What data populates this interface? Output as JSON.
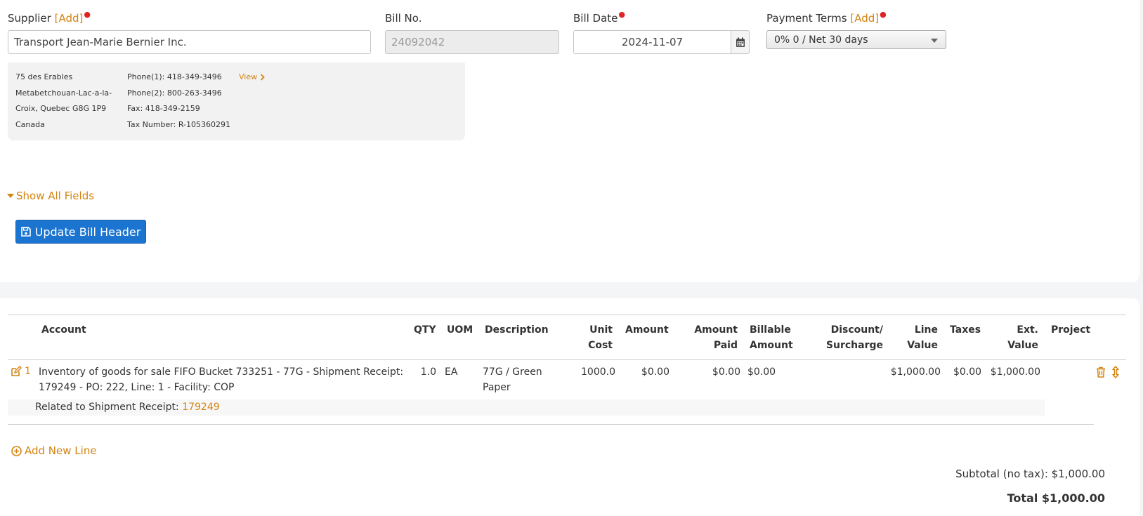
{
  "header": {
    "supplier_label": "Supplier",
    "add_link": "[Add]",
    "bill_no_label": "Bill No.",
    "bill_date_label": "Bill Date",
    "payment_terms_label": "Payment Terms",
    "supplier_value": "Transport Jean-Marie Bernier Inc.",
    "bill_no_value": "24092042",
    "bill_date_value": "2024-11-07",
    "payment_terms_value": "0% 0 / Net 30 days"
  },
  "supplier_info": {
    "address": [
      "75 des Erables",
      "Metabetchouan-Lac-a-la-",
      "Croix, Quebec G8G 1P9",
      "Canada"
    ],
    "contacts": [
      "Phone(1): 418-349-3496",
      "Phone(2): 800-263-3496",
      "Fax: 418-349-2159",
      "Tax Number: R-105360291"
    ],
    "view_link": "View"
  },
  "actions": {
    "show_all_fields": "Show All Fields",
    "update_bill_header": "Update Bill Header",
    "add_new_line": "Add New Line"
  },
  "table": {
    "headers": {
      "account": "Account",
      "qty": "QTY",
      "uom": "UOM",
      "description": "Description",
      "unit_cost_1": "Unit",
      "unit_cost_2": "Cost",
      "amount": "Amount",
      "amount_paid_1": "Amount",
      "amount_paid_2": "Paid",
      "billable_1": "Billable",
      "billable_2": "Amount",
      "discount_1": "Discount/",
      "discount_2": "Surcharge",
      "line_value_1": "Line",
      "line_value_2": "Value",
      "taxes": "Taxes",
      "ext_value_1": "Ext.",
      "ext_value_2": "Value",
      "project": "Project"
    },
    "rows": [
      {
        "line_no": "1",
        "account_1": "Inventory of goods for sale FIFO Bucket 733251 - 77G - Shipment Receipt:",
        "account_2": "179249 - PO: 222, Line: 1 - Facility: COP",
        "qty": "1.0",
        "uom": "EA",
        "description_1": "77G / Green",
        "description_2": "Paper",
        "unit_cost": "1000.0",
        "amount": "$0.00",
        "amount_paid": "$0.00",
        "billable_amount": "$0.00",
        "line_value": "$1,000.00",
        "taxes": "$0.00",
        "ext_value": "$1,000.00",
        "related_label": "Related to Shipment Receipt:",
        "related_link": "179249"
      }
    ]
  },
  "totals": {
    "subtotal": "Subtotal (no tax): $1,000.00",
    "total": "Total $1,000.00"
  },
  "colors": {
    "accent_orange": "#d4830f",
    "primary_blue": "#1b74d0",
    "required_red": "#e02424"
  }
}
